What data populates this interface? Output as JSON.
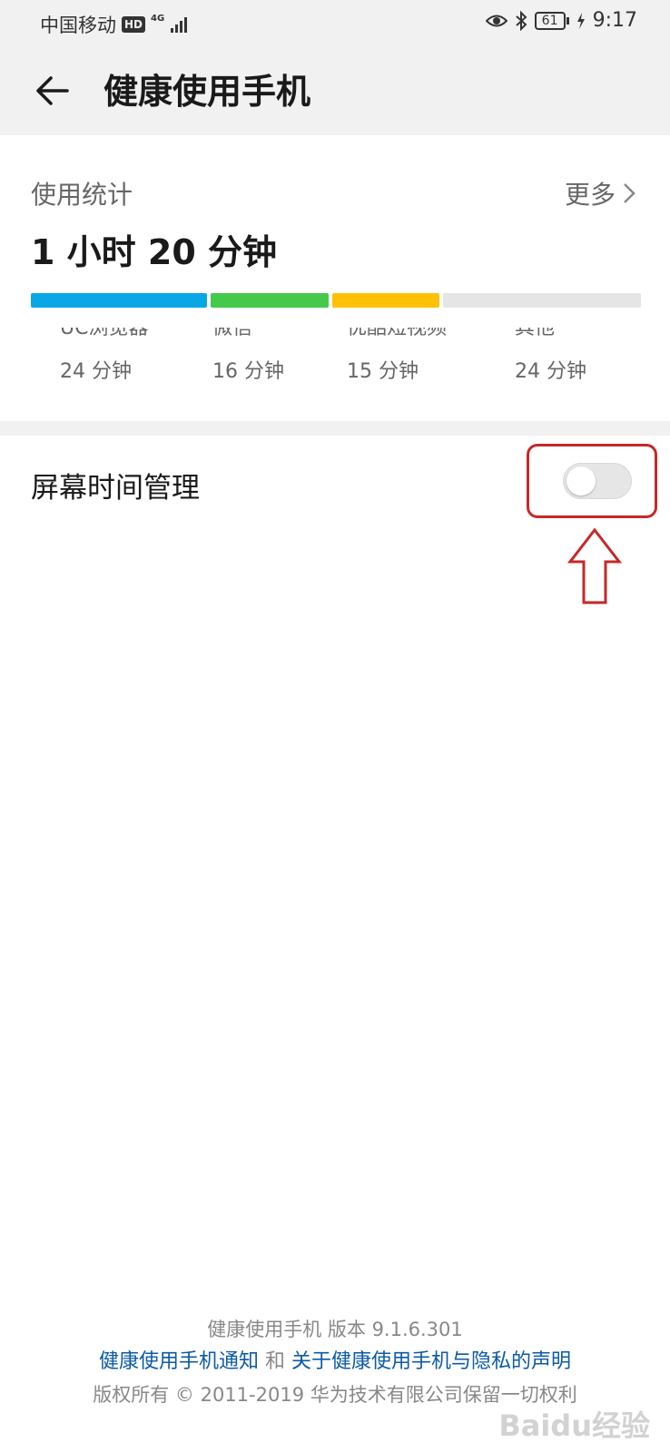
{
  "status_bar": {
    "carrier": "中国移动",
    "hd_badge": "HD",
    "network_type": "4G",
    "battery": "61",
    "time": "9:17",
    "icons": [
      "eye-icon",
      "bluetooth-icon",
      "signal-icon",
      "battery-icon",
      "charging-icon"
    ]
  },
  "header": {
    "title": "健康使用手机",
    "back_icon": "back-arrow-icon"
  },
  "usage_stats": {
    "heading": "使用统计",
    "more_label": "更多",
    "total_time": "1 小时 20 分钟",
    "apps": [
      {
        "name": "UC浏览器",
        "time": "24 分钟",
        "color": "#0aa7e6",
        "minutes": 24
      },
      {
        "name": "微信",
        "time": "16 分钟",
        "color": "#44c94a",
        "minutes": 16
      },
      {
        "name": "优酷短视频",
        "time": "15 分钟",
        "color": "#ffc107",
        "minutes": 15
      },
      {
        "name": "其他",
        "time": "24 分钟",
        "color": "#e5e5e5",
        "minutes": 24
      }
    ]
  },
  "screen_time": {
    "label": "屏幕时间管理",
    "enabled": false
  },
  "footer": {
    "version_line": "健康使用手机 版本 9.1.6.301",
    "notice_link": "健康使用手机通知",
    "and_text": "和",
    "privacy_link": "关于健康使用手机与隐私的声明",
    "copyright": "版权所有 © 2011-2019 华为技术有限公司保留一切权利"
  },
  "watermark": "Baidu经验",
  "annotation_color": "#c62828"
}
